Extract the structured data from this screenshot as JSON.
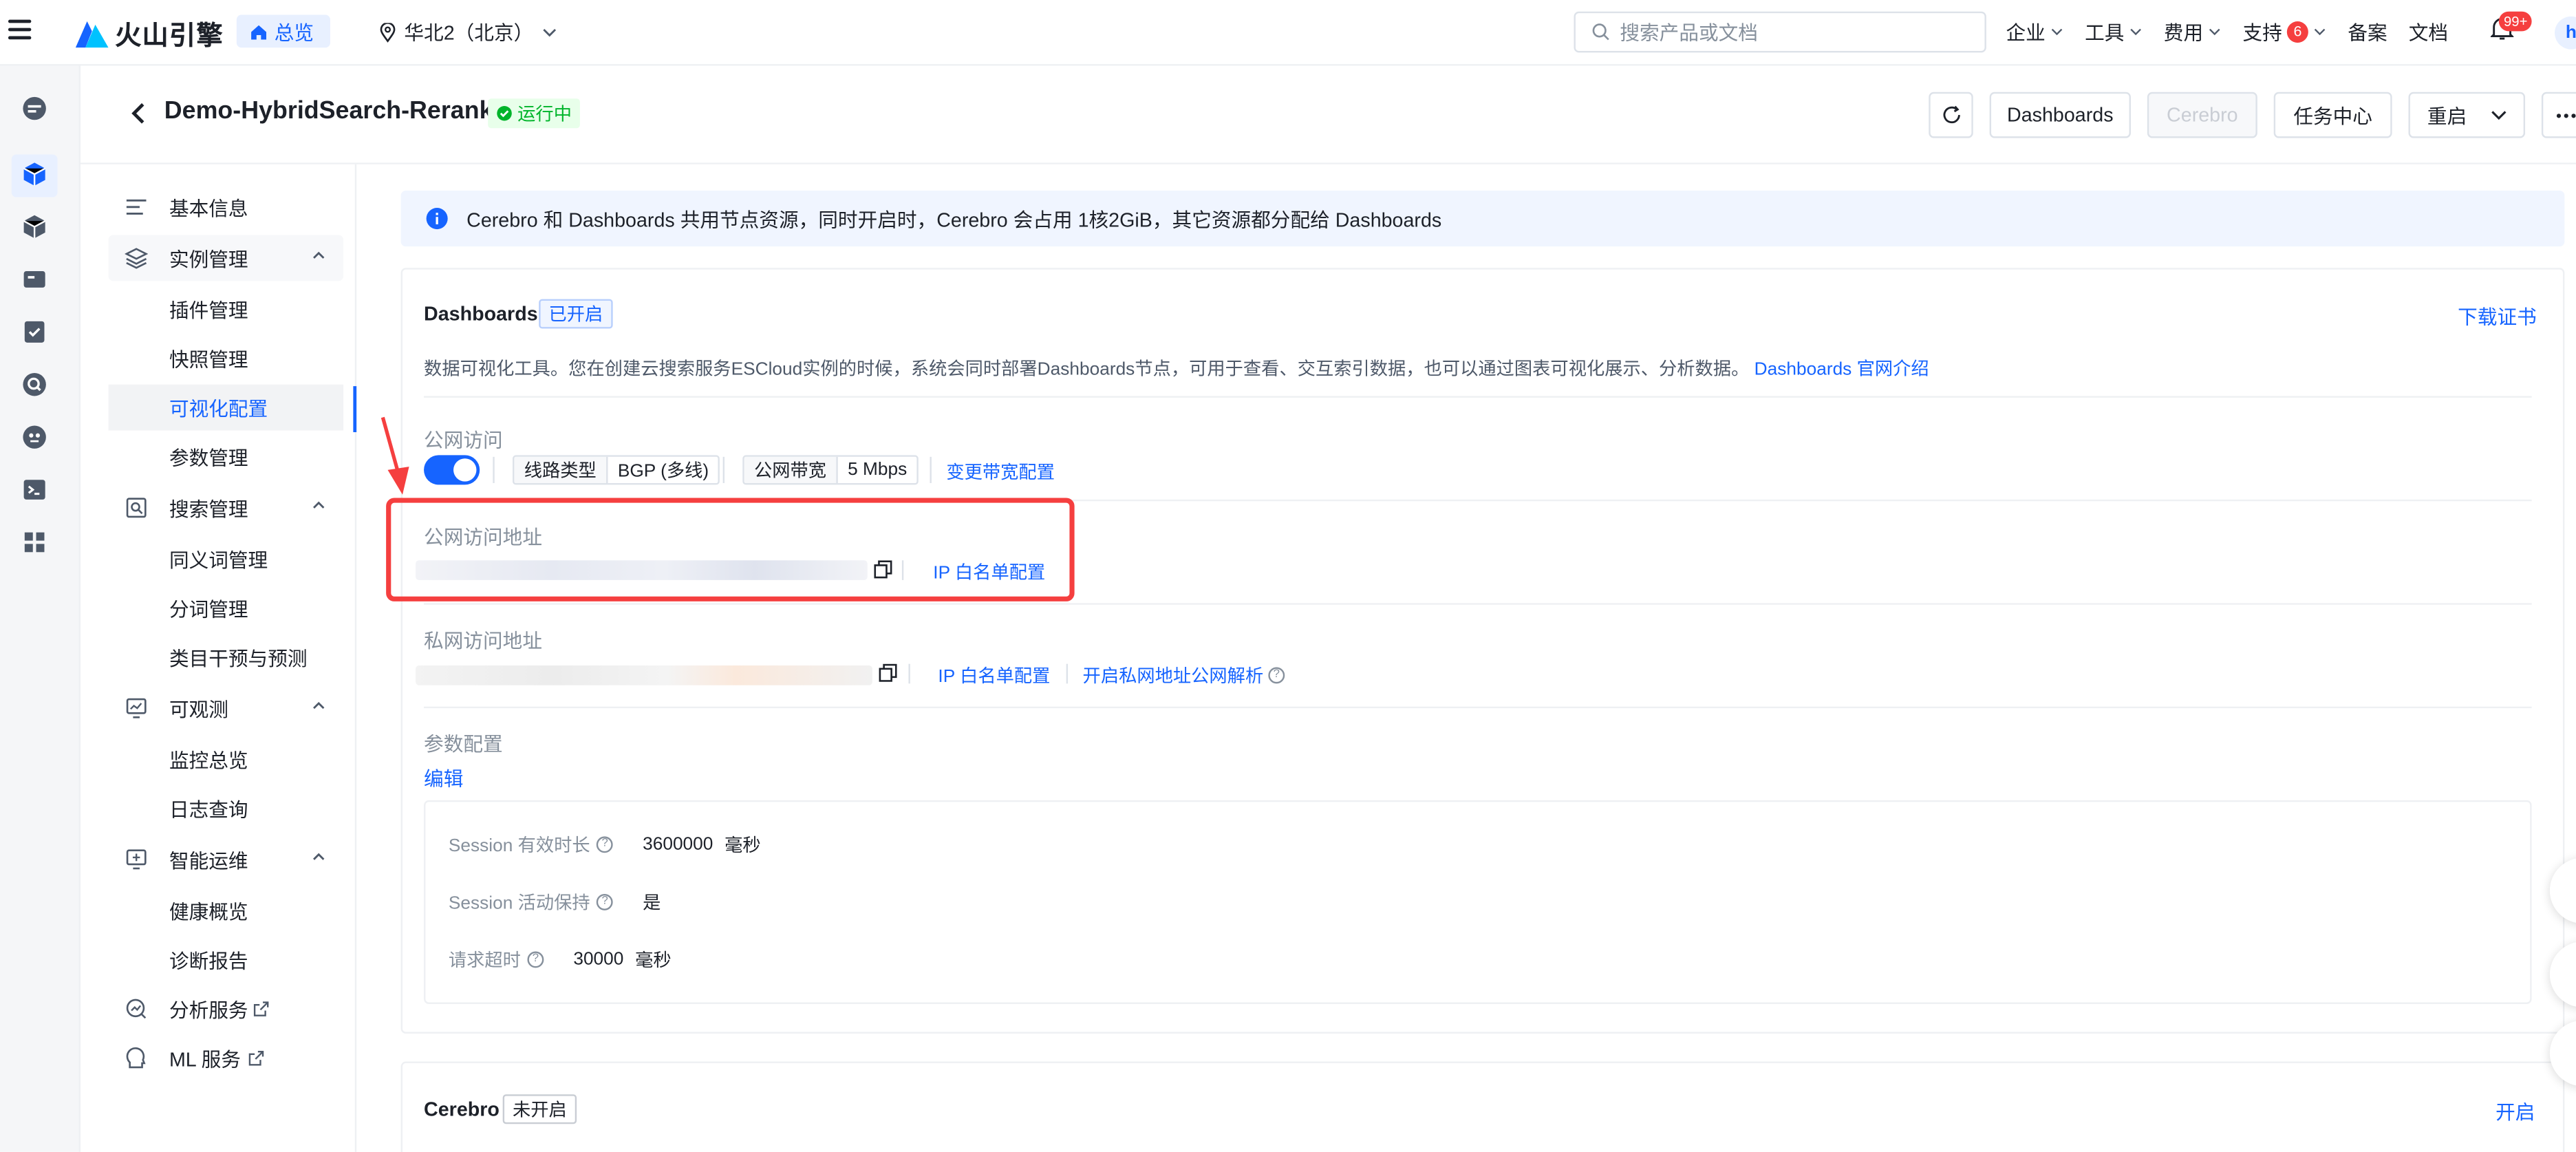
{
  "topbar": {
    "brand": "火山引擎",
    "home_label": "总览",
    "region": "华北2（北京）",
    "search_placeholder": "搜索产品或文档",
    "nav": [
      "企业",
      "工具",
      "费用",
      "支持"
    ],
    "support_badge": "6",
    "filing": "备案",
    "docs": "文档",
    "bell_badge": "99+",
    "avatar_letter": "h"
  },
  "header": {
    "title": "Demo-HybridSearch-Rerank",
    "status": "运行中",
    "buttons": {
      "dashboards": "Dashboards",
      "cerebro": "Cerebro",
      "tasks": "任务中心",
      "restart": "重启"
    }
  },
  "menu": {
    "basic": "基本信息",
    "instance_mgmt": "实例管理",
    "plugin": "插件管理",
    "snapshot": "快照管理",
    "visual_config": "可视化配置",
    "param": "参数管理",
    "search_mgmt": "搜索管理",
    "synonym": "同义词管理",
    "tokenizer": "分词管理",
    "category": "类目干预与预测",
    "observe": "可观测",
    "monitor": "监控总览",
    "log": "日志查询",
    "aiops": "智能运维",
    "health": "健康概览",
    "diagnosis": "诊断报告",
    "analysis": "分析服务",
    "ml": "ML 服务"
  },
  "notice": "Cerebro 和 Dashboards 共用节点资源，同时开启时，Cerebro 会占用 1核2GiB，其它资源都分配给 Dashboards",
  "dashboards": {
    "title": "Dashboards",
    "tag": "已开启",
    "download_cert": "下载证书",
    "desc": "数据可视化工具。您在创建云搜索服务ESCloud实例的时候，系统会同时部署Dashboards节点，可用于查看、交互索引数据，也可以通过图表可视化展示、分析数据。",
    "intro_link": "Dashboards 官网介绍",
    "public_access_label": "公网访问",
    "line_type_key": "线路类型",
    "line_type_val": "BGP (多线)",
    "bandwidth_key": "公网带宽",
    "bandwidth_val": "5 Mbps",
    "change_bandwidth": "变更带宽配置",
    "public_addr_label": "公网访问地址",
    "ip_whitelist": "IP 白名单配置",
    "private_addr_label": "私网访问地址",
    "ip_whitelist2": "IP 白名单配置",
    "private_dns": "开启私网地址公网解析",
    "param_label": "参数配置",
    "edit": "编辑",
    "params": [
      {
        "key": "Session 有效时长",
        "value": "3600000",
        "unit": "毫秒"
      },
      {
        "key": "Session 活动保持",
        "value": "是",
        "unit": ""
      },
      {
        "key": "请求超时",
        "value": "30000",
        "unit": "毫秒"
      }
    ]
  },
  "cerebro": {
    "title": "Cerebro",
    "tag": "未开启",
    "enable": "开启"
  },
  "colors": {
    "accent": "#1664ff",
    "success": "#00b42a",
    "danger": "#f53f3f"
  }
}
